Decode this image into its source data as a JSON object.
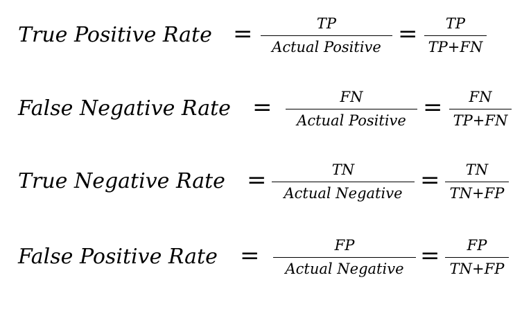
{
  "formulas": [
    {
      "label": "True Positive Rate",
      "eq1": "=",
      "frac1": {
        "num": "TP",
        "den": "Actual Positive"
      },
      "eq2": "=",
      "frac2": {
        "num": "TP",
        "den": "TP+FN"
      }
    },
    {
      "label": "False Negative Rate",
      "eq1": "=",
      "frac1": {
        "num": "FN",
        "den": "Actual Positive"
      },
      "eq2": "=",
      "frac2": {
        "num": "FN",
        "den": "TP+FN"
      }
    },
    {
      "label": "True Negative Rate",
      "eq1": "=",
      "frac1": {
        "num": "TN",
        "den": "Actual Negative"
      },
      "eq2": "=",
      "frac2": {
        "num": "TN",
        "den": "TN+FP"
      }
    },
    {
      "label": "False Positive Rate",
      "eq1": "=",
      "frac1": {
        "num": "FP",
        "den": "Actual Negative"
      },
      "eq2": "=",
      "frac2": {
        "num": "FP",
        "den": "TN+FP"
      }
    }
  ]
}
